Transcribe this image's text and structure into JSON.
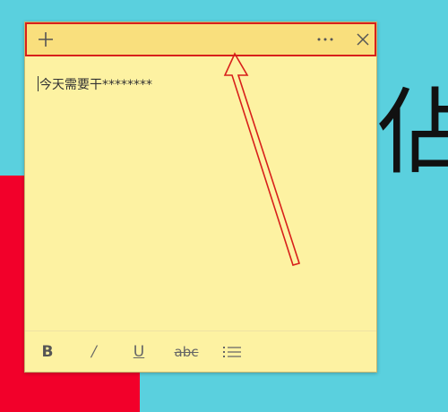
{
  "note": {
    "content": "今天需要干********"
  },
  "titlebar": {
    "icons": [
      "add-icon",
      "more-icon",
      "close-icon"
    ]
  },
  "format_toolbar": {
    "bold": "B",
    "italic": "/",
    "underline": "U",
    "strikethrough": "abc",
    "list_icon": "bullet-list-icon"
  },
  "background": {
    "glyph": "佔"
  },
  "colors": {
    "note_body": "#fdf2a2",
    "note_titlebar": "#f9df7d",
    "highlight": "#d8201b",
    "desktop_cyan": "#5ad0de",
    "desktop_red": "#f2002a"
  }
}
